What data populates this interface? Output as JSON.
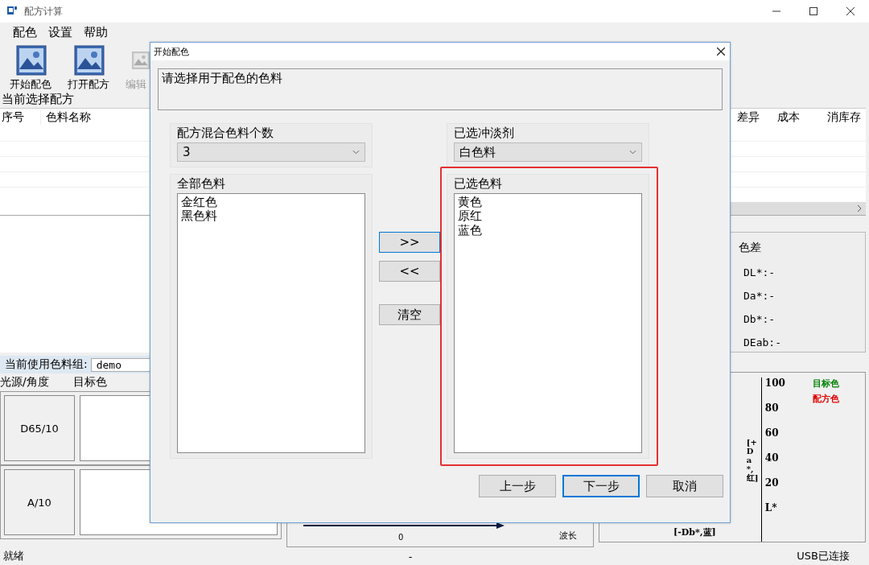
{
  "window": {
    "title": "配方计算"
  },
  "menu": [
    "配色",
    "设置",
    "帮助"
  ],
  "toolbar": [
    {
      "label": "开始配色",
      "disabled": false
    },
    {
      "label": "打开配方",
      "disabled": false
    },
    {
      "label": "编辑",
      "disabled": true
    }
  ],
  "recipe_section": {
    "title": "当前选择配方",
    "columns_left": [
      "序号",
      "色料名称"
    ],
    "columns_right": [
      "差异",
      "成本",
      "消库存"
    ]
  },
  "color_difference": {
    "title": "色差",
    "rows": [
      "DL*:-",
      "Da*:-",
      "Db*:-",
      "DEab:-"
    ]
  },
  "colorant_group": {
    "label": "当前使用色料组:",
    "value": "demo"
  },
  "illuminant_table": {
    "columns": [
      "光源/角度",
      "目标色"
    ],
    "rows": [
      "D65/10",
      "A/10"
    ]
  },
  "spectrum": {
    "tick": "0",
    "xlabel": "波长"
  },
  "lab_chart": {
    "yticks": [
      "100",
      "80",
      "60",
      "40",
      "20"
    ],
    "ylabel": "[+Da*,红]",
    "xlabel": "[-Db*,蓝]",
    "axis": "L*",
    "legend": [
      {
        "label": "目标色",
        "color": "#008000"
      },
      {
        "label": "配方色",
        "color": "#e00000"
      }
    ]
  },
  "status_bar": [
    "就绪",
    "-",
    "USB已连接"
  ],
  "dialog": {
    "title": "开始配色",
    "prompt": "请选择用于配色的色料",
    "count": {
      "label": "配方混合色料个数",
      "value": "3"
    },
    "thinner": {
      "label": "已选冲淡剂",
      "value": "白色料"
    },
    "all_colorants": {
      "label": "全部色料",
      "items": [
        "金红色",
        "黑色料"
      ]
    },
    "selected_colorants": {
      "label": "已选色料",
      "items": [
        "黄色",
        "原红",
        "蓝色"
      ],
      "highlighted": true
    },
    "transfer_buttons": [
      ">>",
      "<<",
      "清空"
    ],
    "buttons": [
      {
        "label": "上一步",
        "default": false
      },
      {
        "label": "下一步",
        "default": true
      },
      {
        "label": "取消",
        "default": false
      }
    ]
  }
}
